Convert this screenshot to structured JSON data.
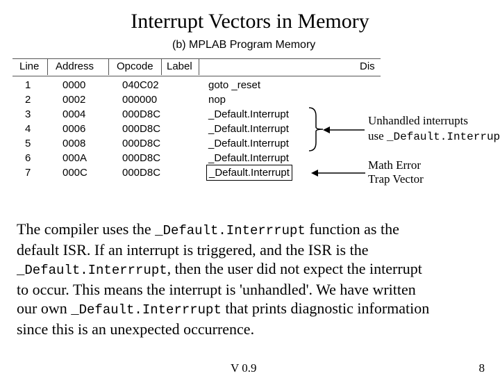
{
  "title": "Interrupt Vectors in Memory",
  "figure_caption": "(b) MPLAB Program Memory",
  "headers": {
    "line": "Line",
    "address": "Address",
    "opcode": "Opcode",
    "label": "Label",
    "dis": "Dis"
  },
  "rows": [
    {
      "line": "1",
      "addr": "0000",
      "op": "040C02",
      "dis": "goto _reset"
    },
    {
      "line": "2",
      "addr": "0002",
      "op": "000000",
      "dis": "nop"
    },
    {
      "line": "3",
      "addr": "0004",
      "op": "000D8C",
      "dis": "_Default.Interrupt"
    },
    {
      "line": "4",
      "addr": "0006",
      "op": "000D8C",
      "dis": "_Default.Interrupt"
    },
    {
      "line": "5",
      "addr": "0008",
      "op": "000D8C",
      "dis": "_Default.Interrupt"
    },
    {
      "line": "6",
      "addr": "000A",
      "op": "000D8C",
      "dis": "_Default.Interrupt"
    },
    {
      "line": "7",
      "addr": "000C",
      "op": "000D8C",
      "dis": "_Default.Interrupt"
    }
  ],
  "annotations": {
    "unhandled1": "Unhandled interrupts",
    "unhandled2_prefix": "use ",
    "unhandled2_code": "_Default.Interrupt",
    "matherror1": "Math Error",
    "matherror2": "Trap Vector"
  },
  "paragraph": {
    "p1a": "The compiler uses the ",
    "p1code": "_Default.Interrrupt",
    "p1b": " function as the default ISR.  If an interrupt is triggered, and the ISR is the ",
    "p2code": "_Default.Interrrupt",
    "p2a": ", then the user did not expect the interrupt to occur. This means the interrupt is 'unhandled'. We have written our own ",
    "p3code": "_Default.Interrrupt",
    "p3a": " that prints diagnostic information since this is an unexpected occurrence."
  },
  "footer": {
    "version": "V 0.9",
    "page": "8"
  }
}
